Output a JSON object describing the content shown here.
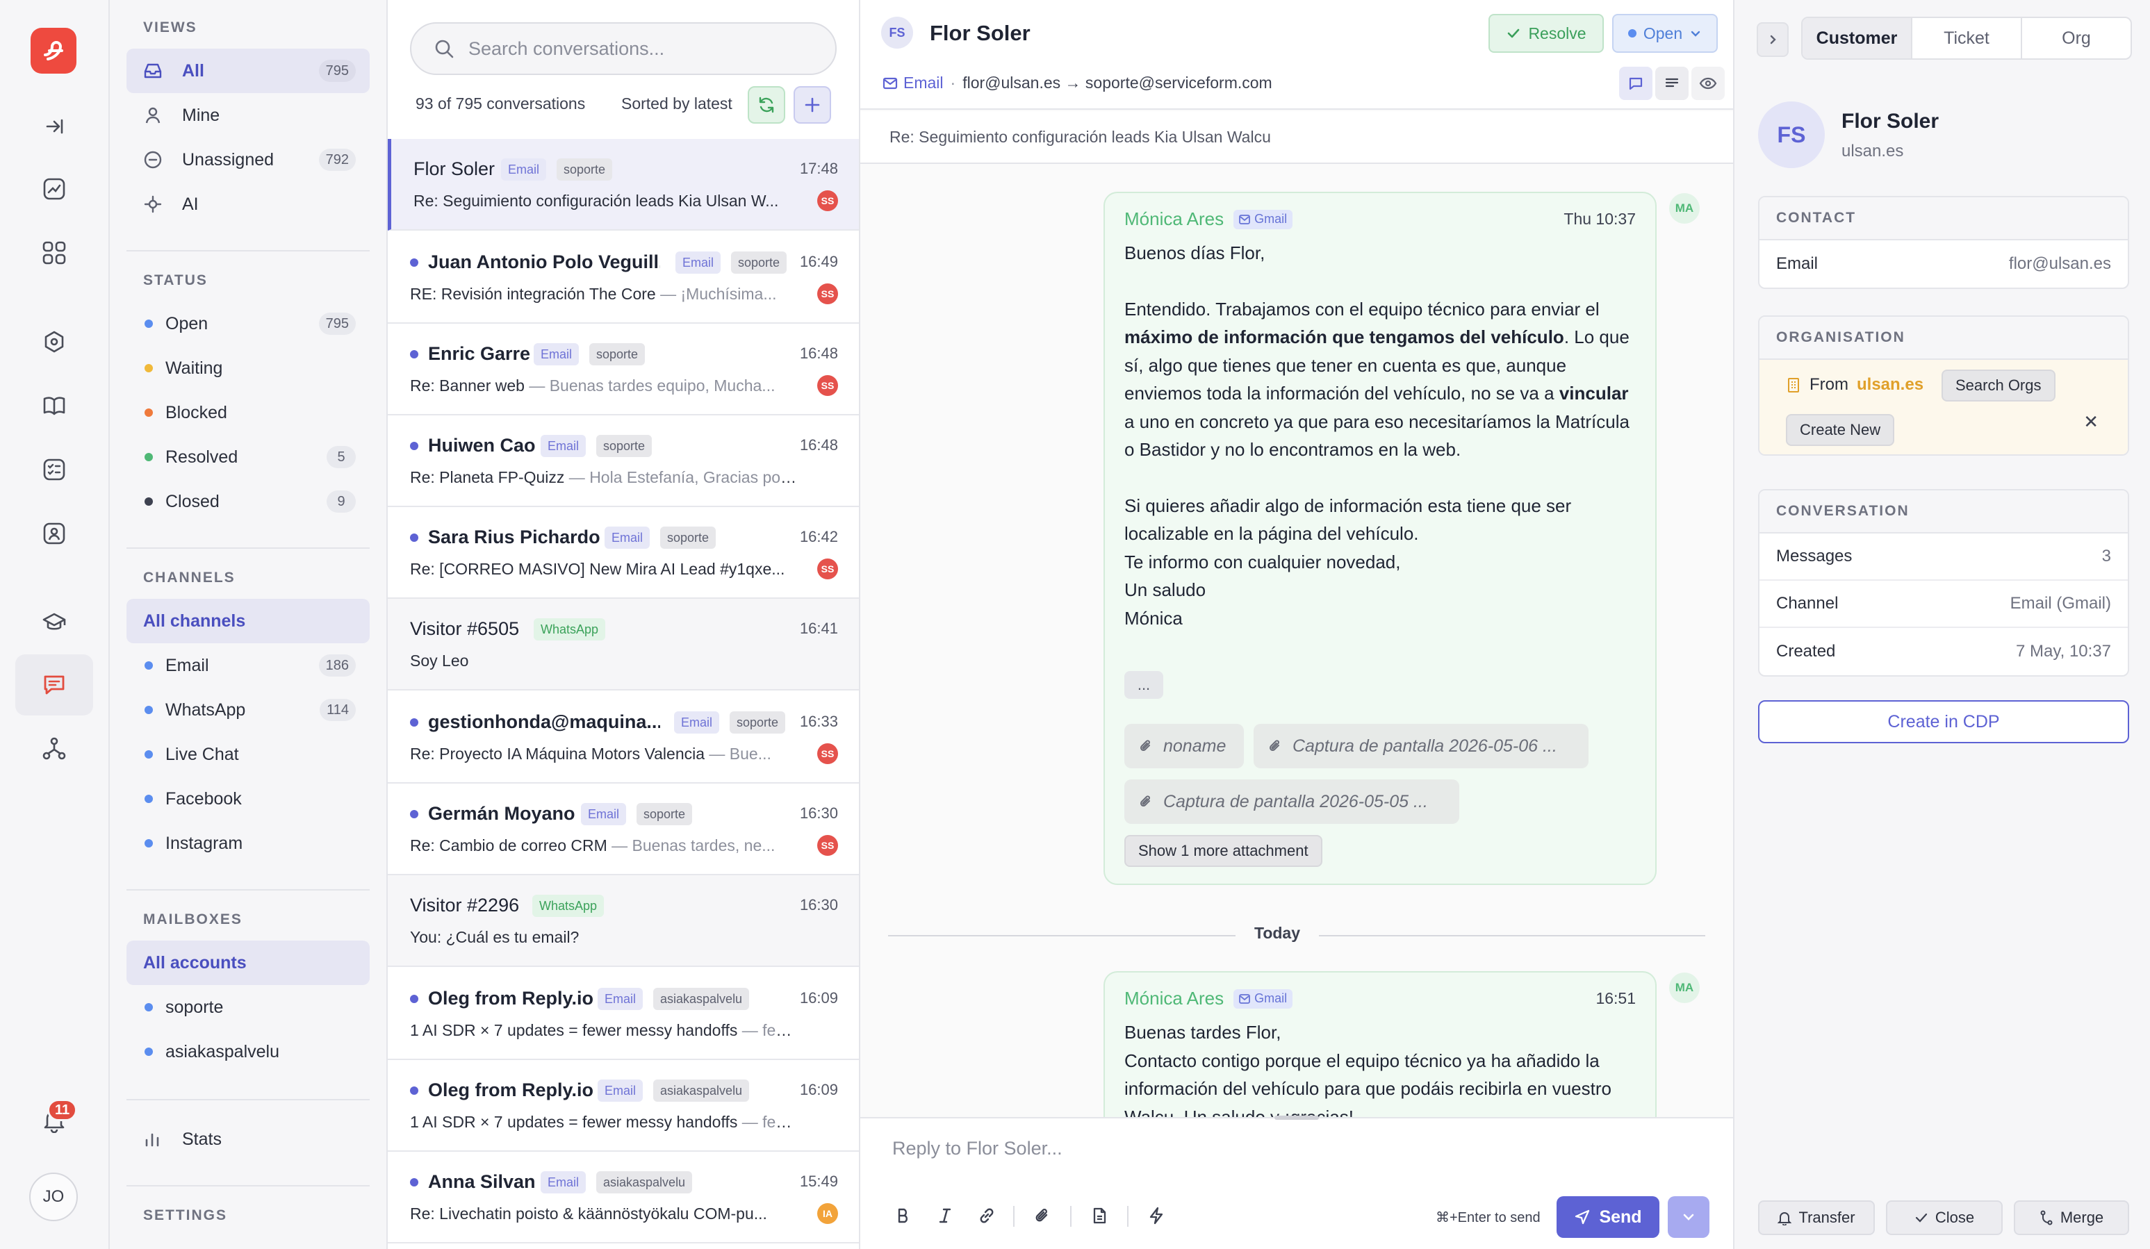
{
  "rail": {
    "notification_count": "11",
    "user_initials": "JO"
  },
  "sidebar": {
    "views_heading": "VIEWS",
    "views": [
      {
        "label": "All",
        "count": "795"
      },
      {
        "label": "Mine",
        "count": ""
      },
      {
        "label": "Unassigned",
        "count": "792"
      },
      {
        "label": "AI",
        "count": ""
      }
    ],
    "status_heading": "STATUS",
    "statuses": [
      {
        "label": "Open",
        "count": "795",
        "color": "#5b8def"
      },
      {
        "label": "Waiting",
        "count": "",
        "color": "#f0b93a"
      },
      {
        "label": "Blocked",
        "count": "",
        "color": "#ef7a3c"
      },
      {
        "label": "Resolved",
        "count": "5",
        "color": "#4fb876"
      },
      {
        "label": "Closed",
        "count": "9",
        "color": "#3d4150"
      }
    ],
    "channels_heading": "CHANNELS",
    "channels": [
      {
        "label": "All channels",
        "count": ""
      },
      {
        "label": "Email",
        "count": "186"
      },
      {
        "label": "WhatsApp",
        "count": "114"
      },
      {
        "label": "Live Chat",
        "count": ""
      },
      {
        "label": "Facebook",
        "count": ""
      },
      {
        "label": "Instagram",
        "count": ""
      }
    ],
    "mailboxes_heading": "MAILBOXES",
    "mailboxes": [
      {
        "label": "All accounts"
      },
      {
        "label": "soporte"
      },
      {
        "label": "asiakaspalvelu"
      }
    ],
    "stats_label": "Stats",
    "settings_heading": "SETTINGS"
  },
  "list": {
    "search_placeholder": "Search conversations...",
    "summary": "93 of 795 conversations",
    "sorted": "Sorted by latest",
    "conversations": [
      {
        "name": "Flor Soler",
        "channel": "Email",
        "tag": "soporte",
        "time": "17:48",
        "subject": "Re: Seguimiento configuración leads Kia Ulsan W...",
        "preview": "",
        "assignee": "SS",
        "unread": false
      },
      {
        "name": "Juan Antonio Polo Veguill...",
        "channel": "Email",
        "tag": "soporte",
        "time": "16:49",
        "subject": "RE: Revisión integración The Core",
        "preview": " — ¡Muchísima...",
        "assignee": "SS",
        "unread": true
      },
      {
        "name": "Enric Garre",
        "channel": "Email",
        "tag": "soporte",
        "time": "16:48",
        "subject": "Re: Banner web",
        "preview": " — Buenas tardes equipo, Mucha...",
        "assignee": "SS",
        "unread": true
      },
      {
        "name": "Huiwen Cao",
        "channel": "Email",
        "tag": "soporte",
        "time": "16:48",
        "subject": "Re: Planeta FP-Quizz",
        "preview": " — Hola Estefanía, Gracias por ...",
        "assignee": "",
        "unread": true
      },
      {
        "name": "Sara Rius Pichardo",
        "channel": "Email",
        "tag": "soporte",
        "time": "16:42",
        "subject": "Re: [CORREO MASIVO] New Mira AI Lead #y1qxe...",
        "preview": "",
        "assignee": "SS",
        "unread": true
      },
      {
        "name": "Visitor #6505",
        "channel": "WhatsApp",
        "tag": "",
        "time": "16:41",
        "subject": "Soy Leo",
        "preview": "",
        "assignee": "",
        "unread": false
      },
      {
        "name": "gestionhonda@maquina...",
        "channel": "Email",
        "tag": "soporte",
        "time": "16:33",
        "subject": "Re: Proyecto IA Máquina Motors Valencia",
        "preview": " — Bue...",
        "assignee": "SS",
        "unread": true
      },
      {
        "name": "Germán Moyano",
        "channel": "Email",
        "tag": "soporte",
        "time": "16:30",
        "subject": "Re: Cambio de correo CRM",
        "preview": " — Buenas tardes, ne...",
        "assignee": "SS",
        "unread": true
      },
      {
        "name": "Visitor #2296",
        "channel": "WhatsApp",
        "tag": "",
        "time": "16:30",
        "subject": "You: ¿Cuál es tu email?",
        "preview": "",
        "assignee": "",
        "unread": false
      },
      {
        "name": "Oleg from Reply.io",
        "channel": "Email",
        "tag": "asiakaspalvelu",
        "time": "16:09",
        "subject": "1 AI SDR × 7 updates = fewer messy handoffs",
        "preview": " — few...",
        "assignee": "",
        "unread": true
      },
      {
        "name": "Oleg from Reply.io",
        "channel": "Email",
        "tag": "asiakaspalvelu",
        "time": "16:09",
        "subject": "1 AI SDR × 7 updates = fewer messy handoffs",
        "preview": " — few...",
        "assignee": "",
        "unread": true
      },
      {
        "name": "Anna Silvan",
        "channel": "Email",
        "tag": "asiakaspalvelu",
        "time": "15:49",
        "subject": "Re: Livechatin poisto & käännöstyökalu COM-pu...",
        "preview": "",
        "assignee": "IA",
        "unread": true
      }
    ]
  },
  "thread": {
    "initials": "FS",
    "title": "Flor Soler",
    "resolve_label": "Resolve",
    "status_label": "Open",
    "channel": "Email",
    "route": "flor@ulsan.es → soporte@serviceform.com",
    "subject": "Re: Seguimiento configuración leads Kia Ulsan Walcu",
    "messages": [
      {
        "sender": "Mónica Ares",
        "source": "Gmail",
        "time": "Thu 10:37",
        "initials": "MA",
        "p1": "Buenos días Flor,",
        "p2a": "Entendido. Trabajamos con el equipo técnico para enviar el ",
        "p2b": "máximo de información que tengamos del vehículo",
        "p2c": ". Lo que sí, algo que tienes que tener en cuenta es que, aunque enviemos toda la información del vehículo, no se va a ",
        "p2d": "vincular",
        "p2e": " a uno en concreto ya que para eso necesitaríamos la Matrícula o Bastidor y no lo encontramos en la web.",
        "p3": "Si quieres añadir algo de información esta tiene que ser localizable en la página del vehículo.",
        "p4": "Te informo con cualquier novedad,",
        "p5": "Un saludo",
        "p6": "Mónica",
        "expand": "...",
        "attachments": [
          "noname",
          "Captura de pantalla 2026-05-06 ...",
          "Captura de pantalla 2026-05-05 ..."
        ],
        "more_attachments": "Show 1 more attachment"
      },
      {
        "sender": "Mónica Ares",
        "source": "Gmail",
        "time": "16:51",
        "initials": "MA",
        "p1": "Buenas tardes Flor,",
        "p2": "Contacto contigo porque el equipo técnico ya ha añadido la información del vehículo para que podáis recibirla en vuestro Walcu. Un saludo y ¡gracias!"
      }
    ],
    "divider": "Today",
    "reply_placeholder": "Reply to Flor Soler...",
    "send_hint": "⌘+Enter to send",
    "send_label": "Send"
  },
  "panel": {
    "tabs": [
      "Customer",
      "Ticket",
      "Org"
    ],
    "initials": "FS",
    "name": "Flor Soler",
    "domain": "ulsan.es",
    "contact_heading": "CONTACT",
    "email_key": "Email",
    "email_value": "flor@ulsan.es",
    "org_heading": "ORGANISATION",
    "org_from": "From",
    "org_domain": "ulsan.es",
    "search_orgs": "Search Orgs",
    "create_new": "Create New",
    "conv_heading": "CONVERSATION",
    "conv_rows": [
      {
        "k": "Messages",
        "v": "3"
      },
      {
        "k": "Channel",
        "v": "Email (Gmail)"
      },
      {
        "k": "Created",
        "v": "7 May, 10:37"
      }
    ],
    "cdp_label": "Create in CDP",
    "footer": [
      "Transfer",
      "Close",
      "Merge"
    ]
  }
}
